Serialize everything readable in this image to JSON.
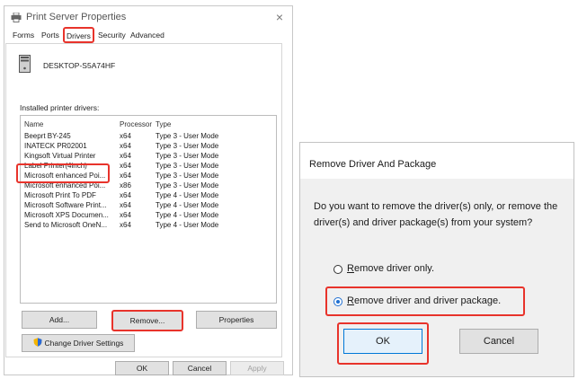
{
  "server_props": {
    "title": "Print Server Properties",
    "close_glyph": "×",
    "tabs": [
      {
        "label": "Forms"
      },
      {
        "label": "Ports"
      },
      {
        "label": "Drivers"
      },
      {
        "label": "Security"
      },
      {
        "label": "Advanced"
      }
    ],
    "server_name": "DESKTOP-S5A74HF",
    "installed_label": "Installed printer drivers:",
    "columns": {
      "name": "Name",
      "processor": "Processor",
      "type": "Type"
    },
    "drivers": [
      {
        "name": "Beeprt BY-245",
        "processor": "x64",
        "type": "Type 3 - User Mode"
      },
      {
        "name": "INATECK PR02001",
        "processor": "x64",
        "type": "Type 3 - User Mode"
      },
      {
        "name": "Kingsoft Virtual Printer",
        "processor": "x64",
        "type": "Type 3 - User Mode"
      },
      {
        "name": "Label Printer(4inch)",
        "processor": "x64",
        "type": "Type 3 - User Mode"
      },
      {
        "name": "Microsoft enhanced Poi...",
        "processor": "x64",
        "type": "Type 3 - User Mode"
      },
      {
        "name": "Microsoft enhanced Poi...",
        "processor": "x86",
        "type": "Type 3 - User Mode"
      },
      {
        "name": "Microsoft Print To PDF",
        "processor": "x64",
        "type": "Type 4 - User Mode"
      },
      {
        "name": "Microsoft Software Print...",
        "processor": "x64",
        "type": "Type 4 - User Mode"
      },
      {
        "name": "Microsoft XPS Documen...",
        "processor": "x64",
        "type": "Type 4 - User Mode"
      },
      {
        "name": "Send to Microsoft OneN...",
        "processor": "x64",
        "type": "Type 4 - User Mode"
      }
    ],
    "buttons": {
      "add": "Add...",
      "remove": "Remove...",
      "properties": "Properties",
      "change_settings": "Change Driver Settings",
      "ok": "OK",
      "cancel": "Cancel",
      "apply": "Apply"
    }
  },
  "remove_dialog": {
    "title": "Remove Driver And Package",
    "question": "Do you want to remove the driver(s) only, or remove the driver(s) and driver package(s) from your system?",
    "option_driver_only": {
      "accel": "R",
      "rest": "emove driver only.",
      "selected": false
    },
    "option_driver_package": {
      "accel": "R",
      "rest": "emove driver and driver package.",
      "selected": true
    },
    "ok": "OK",
    "cancel": "Cancel"
  },
  "colors": {
    "highlight": "#e8332b",
    "accent": "#0078d7"
  }
}
